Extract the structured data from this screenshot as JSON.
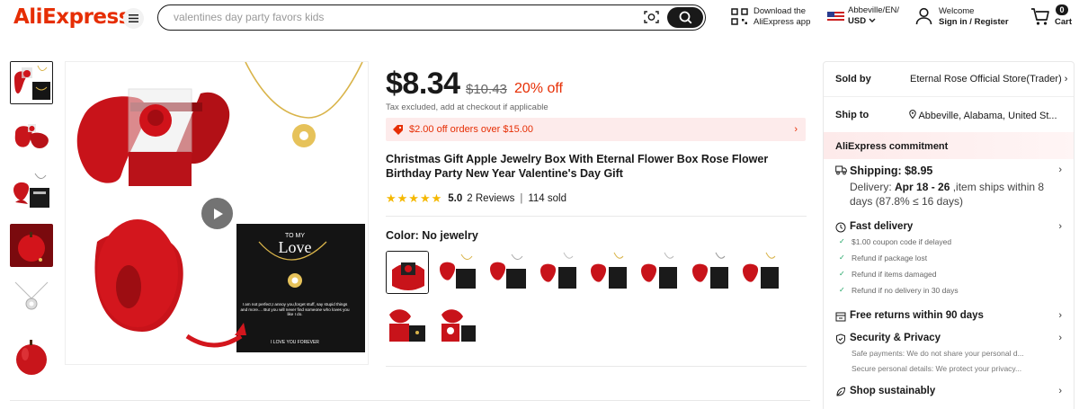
{
  "header": {
    "logo": "AliExpress",
    "search_placeholder": "valentines day party favors kids",
    "app_line1": "Download the",
    "app_line2": "AliExpress app",
    "region_line1": "Abbeville/EN/",
    "region_line2": "USD",
    "welcome": "Welcome",
    "sign_in": "Sign in / Register",
    "cart_count": "0",
    "cart_label": "Cart"
  },
  "product": {
    "price": "$8.34",
    "original_price": "$10.43",
    "discount": "20% off",
    "tax_note": "Tax excluded, add at checkout if applicable",
    "coupon": "$2.00 off orders over $15.00",
    "title": "Christmas Gift Apple Jewelry Box With Eternal Flower Box Rose Flower Birthday Party New Year Valentine's Day Gift",
    "rating": 5.0,
    "rating_text": "5.0",
    "reviews": "2 Reviews",
    "sold": "114 sold",
    "color_label": "Color: No jewelry",
    "swatch_count": 10
  },
  "image_texts": {
    "card_to": "TO MY",
    "card_love": "Love",
    "card_poem": "I am not perfect,I annoy you,forget stuff, say stupid things and more.... But you will never find someone who loves you like I do.",
    "card_footer": "I LOVE YOU FOREVER"
  },
  "panel": {
    "sold_by_label": "Sold by",
    "sold_by_value": "Eternal Rose Official Store(Trader)",
    "ship_to_label": "Ship to",
    "ship_to_value": "Abbeville, Alabama, United St...",
    "commitment": "AliExpress commitment",
    "shipping": "Shipping: $8.95",
    "delivery_prefix": "Delivery: ",
    "delivery_dates": "Apr 18 - 26",
    "delivery_suffix": " ,item ships within 8 days (87.8% ≤ 16 days)",
    "fast_delivery": "Fast delivery",
    "fast_items": [
      "$1.00 coupon code if delayed",
      "Refund if package lost",
      "Refund if items damaged",
      "Refund if no delivery in 30 days"
    ],
    "free_returns": "Free returns within 90 days",
    "security": "Security & Privacy",
    "security_items": [
      "Safe payments: We do not share your personal d...",
      "Secure personal details: We protect your privacy..."
    ],
    "sustainably": "Shop sustainably"
  },
  "colors": {
    "brand_red": "#e62e04",
    "star": "#f5b800",
    "coupon_bg": "#fdebeb"
  }
}
